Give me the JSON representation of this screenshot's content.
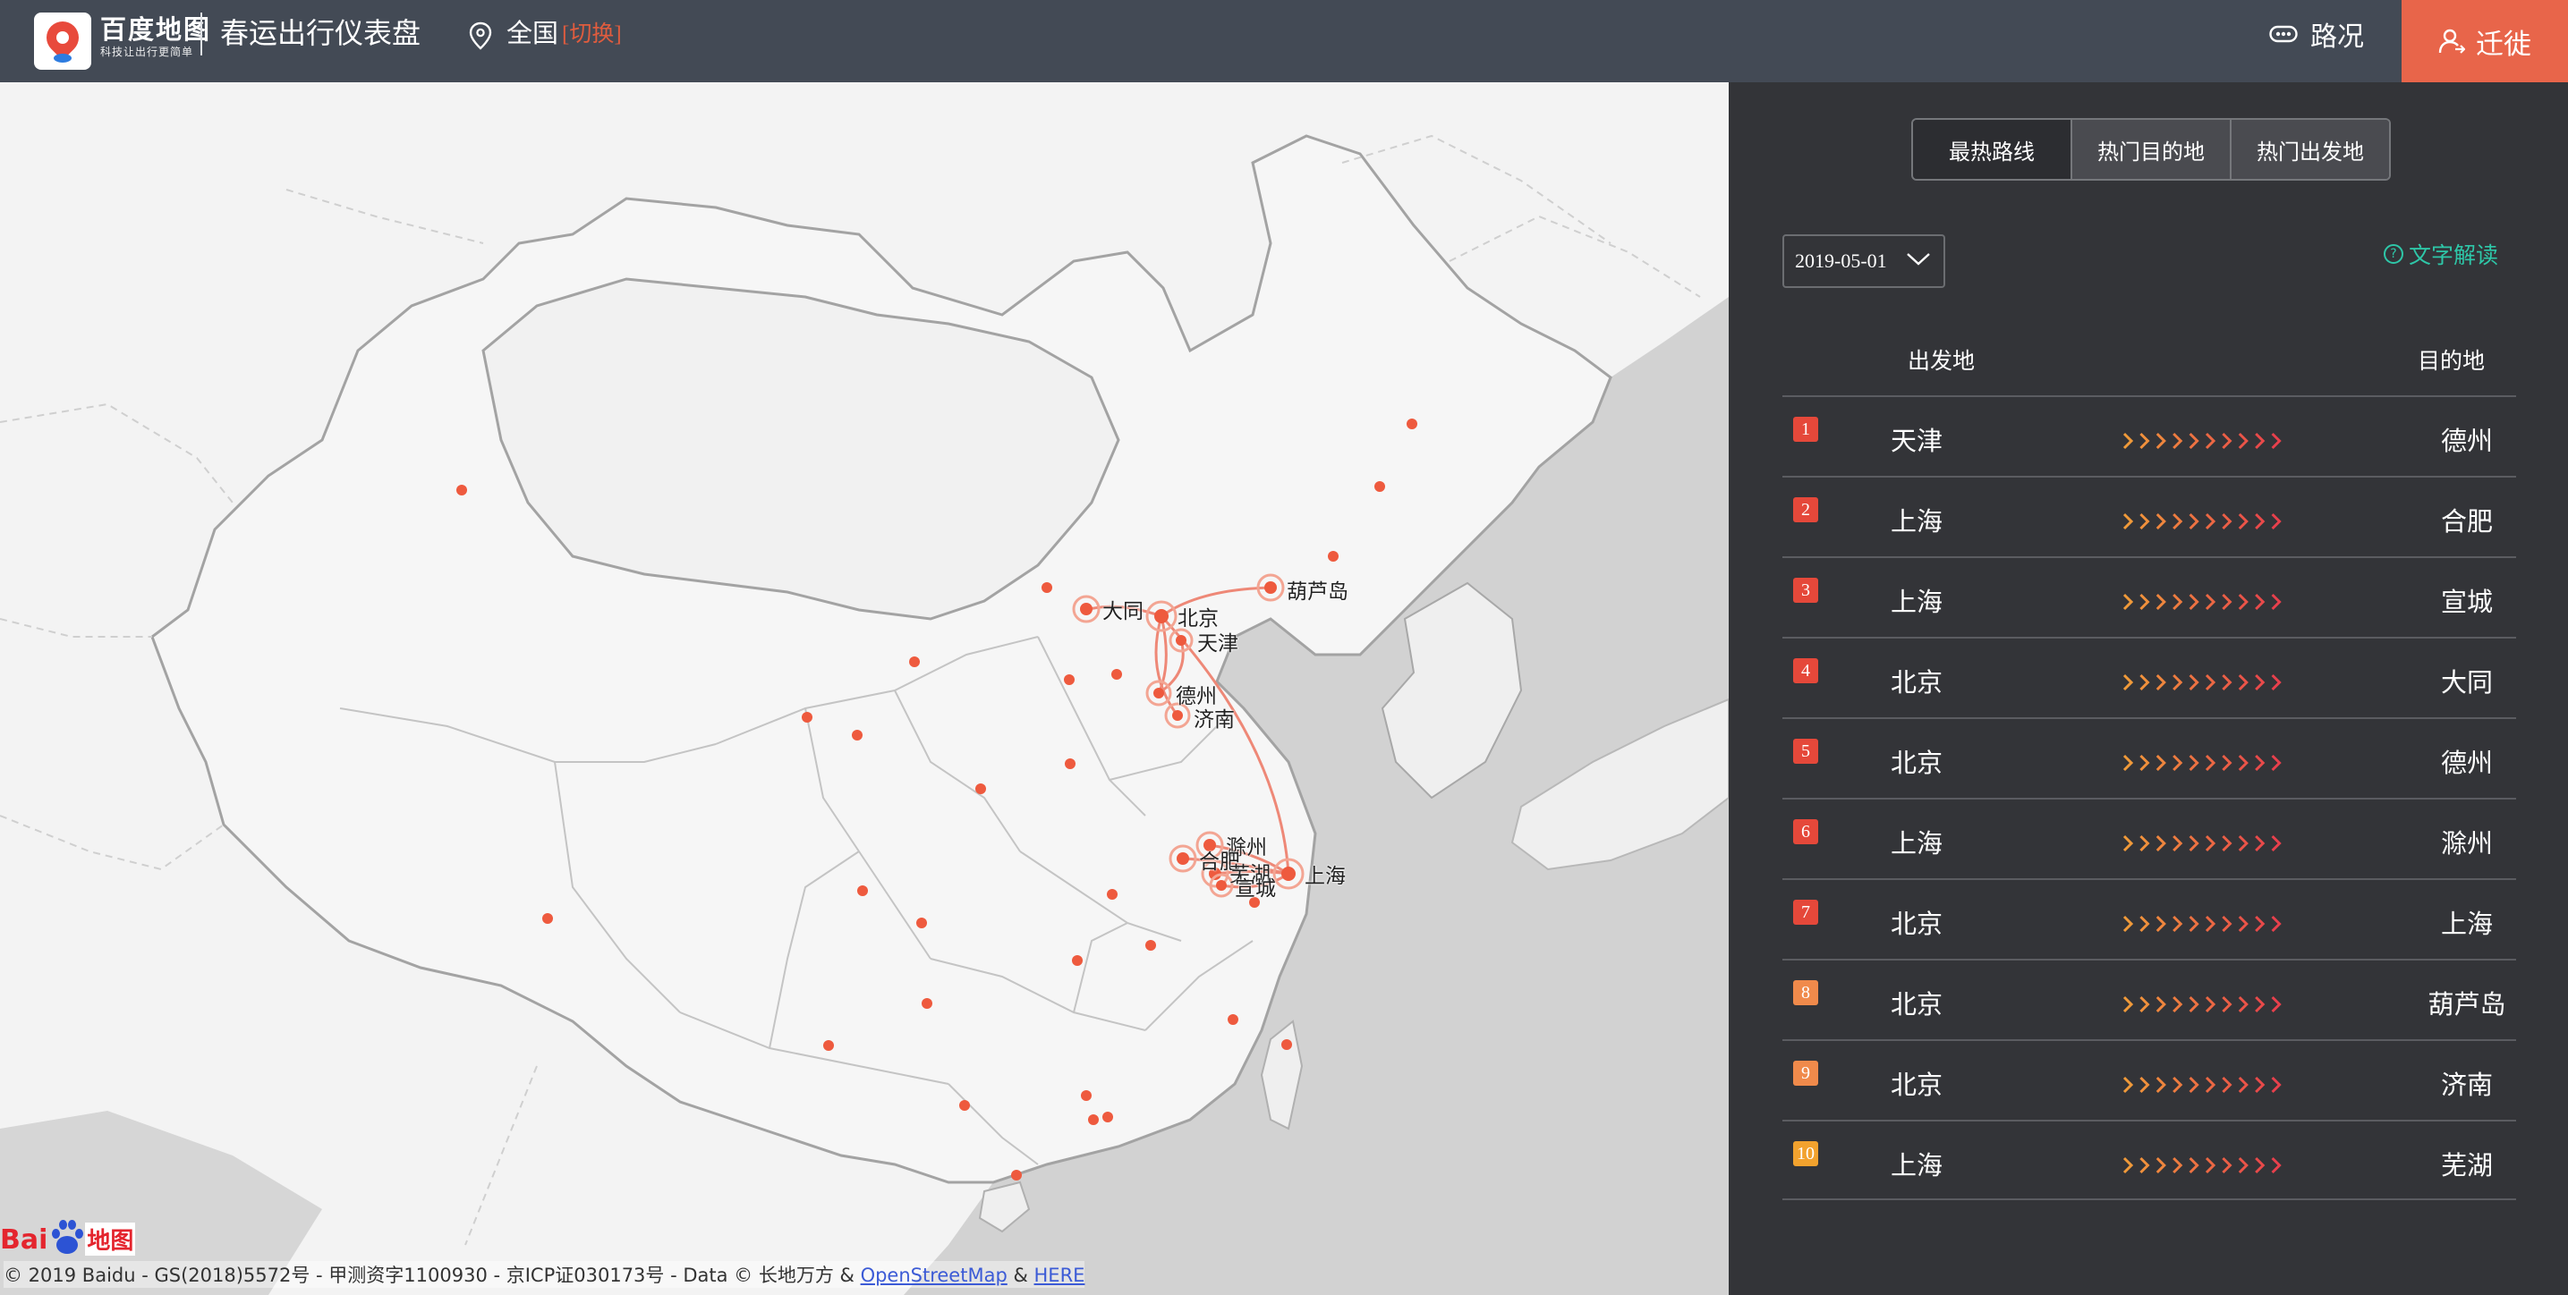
{
  "header": {
    "brand_name": "百度地图",
    "brand_slogan": "科技让出行更简单",
    "app_title": "春运出行仪表盘",
    "location": "全国",
    "location_switch": "[切换]",
    "traffic_label": "路况",
    "migrate_label": "迁徙"
  },
  "map": {
    "cities": {
      "datong": "大同",
      "beijing": "北京",
      "tianjin": "天津",
      "huludao": "葫芦岛",
      "dezhou": "德州",
      "jinan": "济南",
      "chuzhou": "滁州",
      "hefei": "合肥",
      "wuhu": "芜湖",
      "xuancheng": "宣城",
      "shanghai": "上海"
    },
    "baidu_logo": {
      "b1": "Bai",
      "b2": "地图"
    },
    "copyright_prefix": "© 2019 Baidu - GS(2018)5572号 - 甲测资字1100930 - 京ICP证030173号 - Data © 长地万方 & ",
    "osm_link": "OpenStreetMap",
    "amp": " & ",
    "here_link": "HERE"
  },
  "panel": {
    "tabs": [
      "最热路线",
      "热门目的地",
      "热门出发地"
    ],
    "date": "2019-05-01",
    "explain": "文字解读",
    "col_from": "出发地",
    "col_to": "目的地",
    "routes": [
      {
        "rank": "1",
        "from": "天津",
        "to": "德州",
        "color": "#e5483a"
      },
      {
        "rank": "2",
        "from": "上海",
        "to": "合肥",
        "color": "#e5483a"
      },
      {
        "rank": "3",
        "from": "上海",
        "to": "宣城",
        "color": "#e5483a"
      },
      {
        "rank": "4",
        "from": "北京",
        "to": "大同",
        "color": "#e5483a"
      },
      {
        "rank": "5",
        "from": "北京",
        "to": "德州",
        "color": "#e5483a"
      },
      {
        "rank": "6",
        "from": "上海",
        "to": "滁州",
        "color": "#e5483a"
      },
      {
        "rank": "7",
        "from": "北京",
        "to": "上海",
        "color": "#e5483a"
      },
      {
        "rank": "8",
        "from": "北京",
        "to": "葫芦岛",
        "color": "#f08a4b"
      },
      {
        "rank": "9",
        "from": "北京",
        "to": "济南",
        "color": "#f08a4b"
      },
      {
        "rank": "10",
        "from": "上海",
        "to": "芜湖",
        "color": "#f2a22e"
      }
    ]
  },
  "colors": {
    "accent": "#e8654a",
    "header_bg": "#434a55",
    "panel_bg": "#333438",
    "link": "#2ec7a8"
  }
}
